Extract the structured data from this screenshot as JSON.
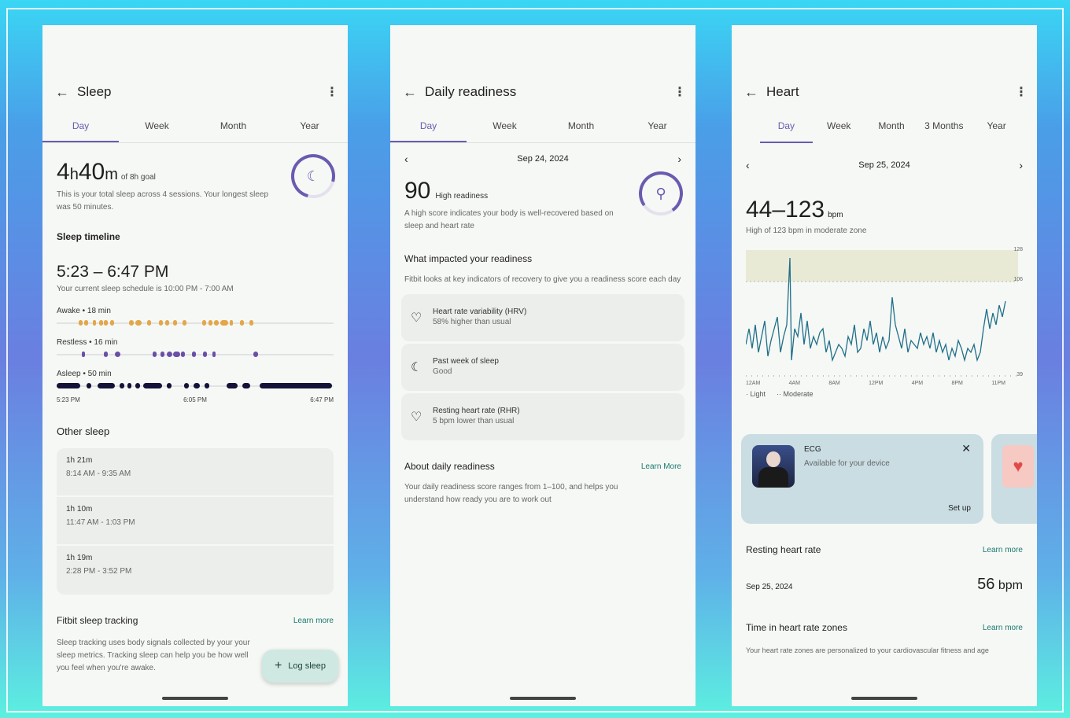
{
  "sleep": {
    "title": "Sleep",
    "tabs": [
      "Day",
      "Week",
      "Month",
      "Year"
    ],
    "hours": "4",
    "h": "h",
    "minutes": "40",
    "m": "m",
    "goal": "of 8h goal",
    "summary": "This is your total sleep across 4 sessions. Your longest sleep was 50 minutes.",
    "timeline_title": "Sleep timeline",
    "range": "5:23 – 6:47 PM",
    "schedule": "Your current sleep schedule is 10:00 PM - 7:00 AM",
    "awake": "Awake • 18 min",
    "restless": "Restless • 16 min",
    "asleep": "Asleep • 50 min",
    "t_start": "5:23 PM",
    "t_mid": "6:05 PM",
    "t_end": "6:47 PM",
    "other_title": "Other sleep",
    "other": [
      {
        "duration": "1h 21m",
        "range": "8:14 AM - 9:35 AM"
      },
      {
        "duration": "1h 10m",
        "range": "11:47 AM - 1:03 PM"
      },
      {
        "duration": "1h 19m",
        "range": "2:28 PM - 3:52 PM"
      }
    ],
    "tracking_title": "Fitbit sleep tracking",
    "learn": "Learn more",
    "tracking_text": "Sleep tracking uses body signals collected by your your sleep metrics. Tracking sleep can help you be how well you feel when you're awake.",
    "fab": "Log sleep",
    "colors": {
      "awake": "#e3a74a",
      "restless": "#6a4fa8",
      "asleep": "#15123a"
    }
  },
  "readiness": {
    "title": "Daily readiness",
    "tabs": [
      "Day",
      "Week",
      "Month",
      "Year"
    ],
    "date": "Sep 24, 2024",
    "score": "90",
    "score_label": "High readiness",
    "desc": "A high score indicates your body is well-recovered based on sleep and heart rate",
    "impact_title": "What impacted your readiness",
    "impact_desc": "Fitbit looks at key indicators of recovery to give you a readiness score each day",
    "items": [
      {
        "title": "Heart rate variability (HRV)",
        "sub": "58% higher than usual",
        "icon": "♡"
      },
      {
        "title": "Past week of sleep",
        "sub": "Good",
        "icon": "☾"
      },
      {
        "title": "Resting heart rate (RHR)",
        "sub": "5 bpm lower than usual",
        "icon": "♡"
      }
    ],
    "about_title": "About daily readiness",
    "learn": "Learn More",
    "about_text": "Your daily readiness score ranges from 1–100, and helps you understand how ready you are to work out"
  },
  "heart": {
    "title": "Heart",
    "tabs": [
      "Day",
      "Week",
      "Month",
      "3 Months",
      "Year"
    ],
    "date": "Sep 25, 2024",
    "range": "44–123",
    "unit": "bpm",
    "sub": "High of 123 bpm in moderate zone",
    "y_max": "128",
    "y_mid": "106",
    "y_min": "39",
    "x_labels": [
      "12AM",
      "4AM",
      "8AM",
      "12PM",
      "4PM",
      "8PM",
      "11PM"
    ],
    "legend_light": "Light",
    "legend_moderate": "Moderate",
    "ecg_title": "ECG",
    "ecg_sub": "Available for your device",
    "setup": "Set up",
    "rhr_title": "Resting heart rate",
    "learn": "Learn more",
    "rhr_date": "Sep 25, 2024",
    "rhr_value": "56",
    "rhr_unit": "bpm",
    "zones_title": "Time in heart rate zones",
    "zones_text": "Your heart rate zones are personalized to your cardiovascular fitness and age",
    "chart_color": "#1f6f8a"
  }
}
